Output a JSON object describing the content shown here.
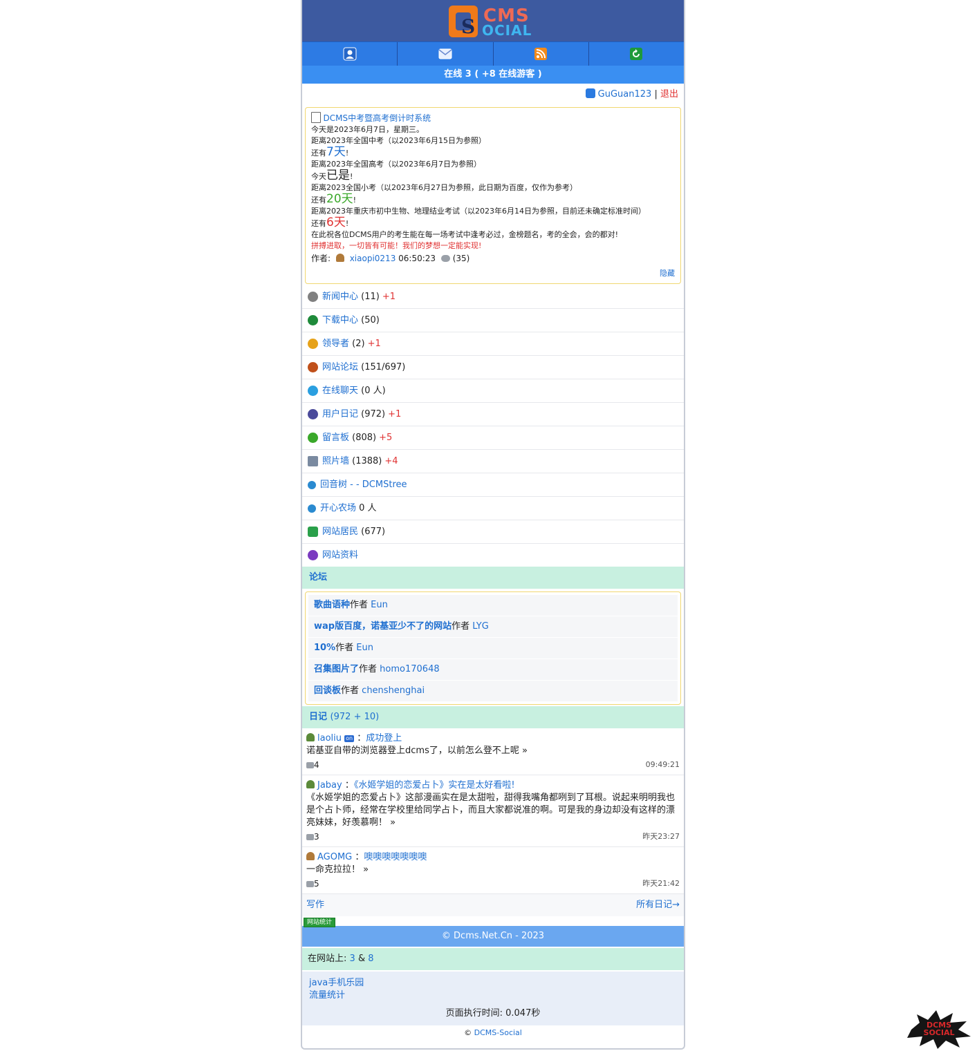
{
  "logo": {
    "letters_cms": "CMS",
    "letters_social": "OCIAL",
    "letter_s": "S"
  },
  "nav": {
    "icons": [
      "user-icon",
      "mail-icon",
      "rss-icon",
      "refresh-icon"
    ]
  },
  "online": {
    "text": "在线 3 ( +8 在线游客 )"
  },
  "user": {
    "name": "GuGuan123",
    "sep": "|",
    "logout": "退出"
  },
  "notice": {
    "title": "DCMS中考暨高考倒计时系统",
    "lines": [
      "今天是2023年6月7日，星期三。",
      "距离2023年全国中考（以2023年6月15日为参照）",
      "距离2023年全国高考（以2023年6月7日为参照）",
      "距离2023全国小考（以2023年6月27日为参照，此日期为百度，仅作为参考）",
      "距离2023年重庆市初中生物、地理结业考试（以2023年6月14日为参照，目前还未确定标准时间）",
      "在此祝各位DCMS用户的考生能在每一场考试中逢考必过，金榜题名，考的全会，会的都对!"
    ],
    "r1_prefix": "还有",
    "r1_value": "7天",
    "r1_suffix": "!",
    "r2_prefix": "今天",
    "r2_value": "已是",
    "r2_suffix": "!",
    "r3_prefix": "还有",
    "r3_value": "20天",
    "r3_suffix": "!",
    "r4_prefix": "还有",
    "r4_value": "6天",
    "r4_suffix": "!",
    "slogan": "拼搏进取，一切皆有可能！我们的梦想一定能实现!",
    "author_label": "作者:",
    "author": "xiaopi0213",
    "time": "06:50:23",
    "comments": "(35)",
    "hide": "隐藏"
  },
  "menu": [
    {
      "label": "新闻中心",
      "count": "(11)",
      "plus": "+1",
      "icon": "news-icon",
      "color": "#808080"
    },
    {
      "label": "下载中心",
      "count": "(50)",
      "plus": "",
      "icon": "download-icon",
      "color": "#1e8a3a"
    },
    {
      "label": "领导者",
      "count": "(2)",
      "plus": "+1",
      "icon": "trophy-icon",
      "color": "#e6a21a"
    },
    {
      "label": "网站论坛",
      "count": "(151/697)",
      "plus": "",
      "icon": "pencil-icon",
      "color": "#c0501a"
    },
    {
      "label": "在线聊天",
      "count": "(0 人)",
      "plus": "",
      "icon": "chat-icon",
      "color": "#2a9fe0"
    },
    {
      "label": "用户日记",
      "count": "(972)",
      "plus": "+1",
      "icon": "diary-icon",
      "color": "#4a4a9a"
    },
    {
      "label": "留言板",
      "count": "(808)",
      "plus": "+5",
      "icon": "guestbook-icon",
      "color": "#3aa82a"
    },
    {
      "label": "照片墙",
      "count": "(1388)",
      "plus": "+4",
      "icon": "photo-icon",
      "color": "#7a8aa0"
    },
    {
      "label": "回音树 -",
      "count": "- DCMStree",
      "plus": "",
      "icon": "tree-icon",
      "color": "#2a8ad0"
    },
    {
      "label": "开心农场",
      "count": "0 人",
      "plus": "",
      "icon": "farm-icon",
      "color": "#2a8ad0"
    },
    {
      "label": "网站居民",
      "count": "(677)",
      "plus": "",
      "icon": "residents-icon",
      "color": "#2aa04a"
    },
    {
      "label": "网站资料",
      "count": "",
      "plus": "",
      "icon": "help-icon",
      "color": "#7a3ac0"
    }
  ],
  "forum": {
    "heading": "论坛",
    "author_label": "作者",
    "threads": [
      {
        "title": "歌曲语种",
        "author": "Eun"
      },
      {
        "title": "wap版百度，诺基亚少不了的网站",
        "author": "LYG"
      },
      {
        "title": "10%",
        "author": "Eun"
      },
      {
        "title": "召集图片了",
        "author": "homo170648"
      },
      {
        "title": "回谈板",
        "author": "chenshenghai"
      }
    ]
  },
  "diary": {
    "heading": "日记",
    "count": "(972 + 10)",
    "entries": [
      {
        "user": "laoliu",
        "badge": "on",
        "colon": "：",
        "title": "成功登上",
        "body": "诺基亚自带的浏览器登上dcms了，以前怎么登不上呢 »",
        "replies": "4",
        "time": "09:49:21"
      },
      {
        "user": "Jabay",
        "badge": "",
        "colon": "：",
        "title": "《水姬学姐的恋爱占卜》实在是太好看啦!",
        "body": "《水姬学姐的恋爱占卜》这部漫画实在是太甜啦，甜得我嘴角都咧到了耳根。说起来明明我也是个占卜师，经常在学校里给同学占卜，而且大家都说准的啊。可是我的身边却没有这样的漂亮妹妹，好羡慕啊！ »",
        "replies": "3",
        "time": "昨天23:27"
      },
      {
        "user": "AGOMG",
        "badge": "",
        "colon": "：",
        "title": "噢噢噢噢噢噢噢",
        "body": "一命克拉拉！ »",
        "replies": "5",
        "time": "昨天21:42"
      }
    ],
    "write": "写作",
    "all": "所有日记→"
  },
  "stat_badge": "网站统计",
  "copyright": "© Dcms.Net.Cn - 2023",
  "insite": {
    "label": "在网站上:",
    "a": "3",
    "amp": "&",
    "b": "8"
  },
  "links": {
    "java": "java手机乐园",
    "traffic": "流量统计",
    "exec": "页面执行时间: 0.047秒"
  },
  "bottom": {
    "c": "©",
    "link": "DCMS-Social"
  },
  "corner": {
    "text": "DCMS SOCIAL"
  }
}
